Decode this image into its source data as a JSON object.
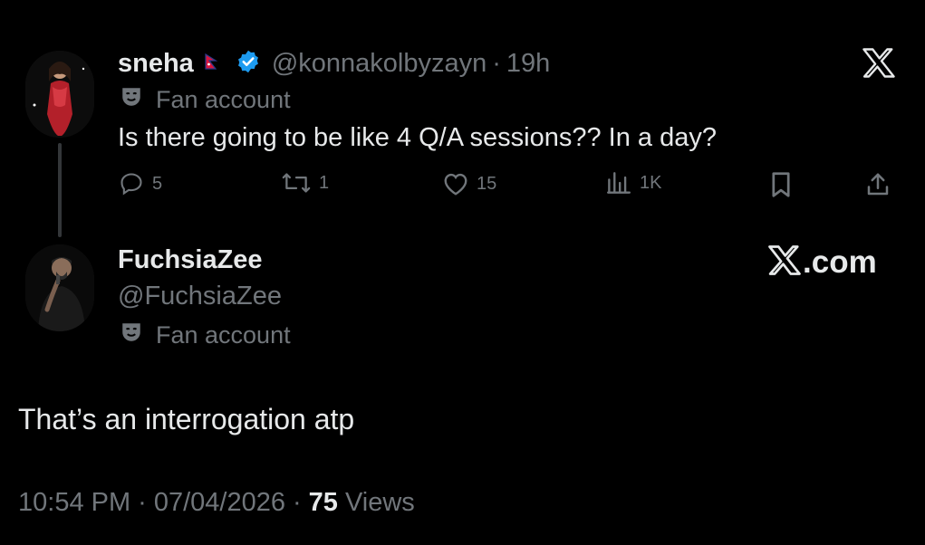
{
  "reply_to": {
    "display_name": "sneha",
    "flag_icon": "nepal-flag-icon",
    "verified_icon": "verified-badge-icon",
    "handle": "@konnakolbyzayn",
    "separator": "·",
    "time": "19h",
    "label": "Fan account",
    "text": "Is there going to be like 4 Q/A sessions?? In a day?",
    "actions": {
      "replies": "5",
      "reposts": "1",
      "likes": "15",
      "views": "1K"
    }
  },
  "post": {
    "display_name": "FuchsiaZee",
    "handle": "@FuchsiaZee",
    "label": "Fan account",
    "text": "That’s an interrogation atp",
    "time": "10:54 PM",
    "date": "07/04/2026",
    "views_count": "75",
    "views_label": "Views",
    "separator": "·"
  },
  "branding": {
    "logo_icon": "x-logo-icon",
    "domain_suffix": ".com"
  },
  "colors": {
    "background": "#000000",
    "text": "#e7e9ea",
    "secondary": "#71767b",
    "verified": "#1d9bf0"
  }
}
